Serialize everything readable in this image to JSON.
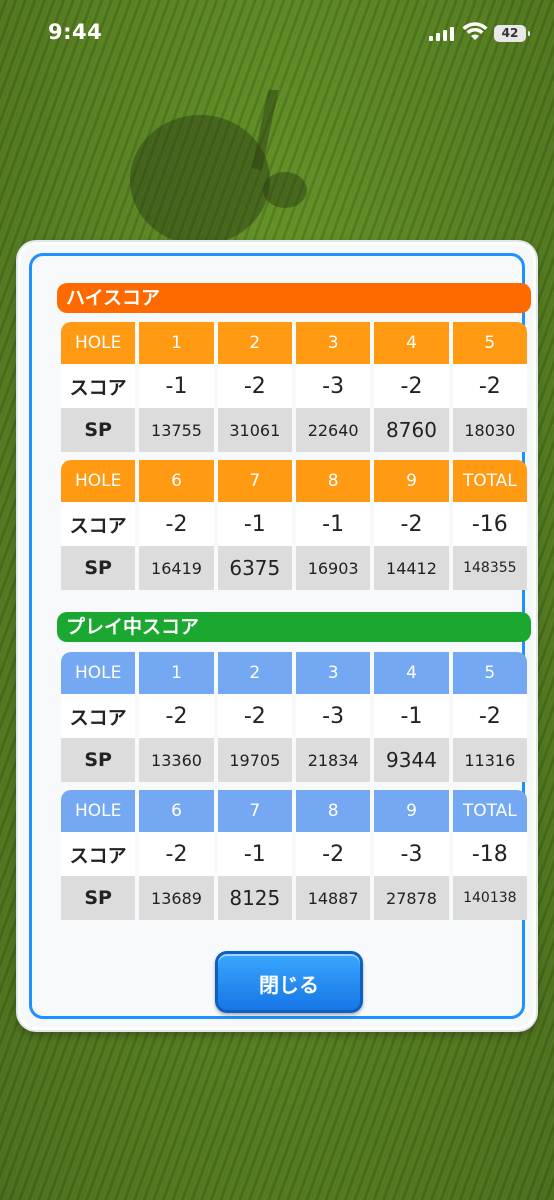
{
  "status_bar": {
    "time": "9:44",
    "battery": "42"
  },
  "high_score": {
    "title": "ハイスコア",
    "front": {
      "header": [
        "HOLE",
        "1",
        "2",
        "3",
        "4",
        "5"
      ],
      "score": [
        "スコア",
        "-1",
        "-2",
        "-3",
        "-2",
        "-2"
      ],
      "sp": [
        "SP",
        "13755",
        "31061",
        "22640",
        "8760",
        "18030"
      ]
    },
    "back": {
      "header": [
        "HOLE",
        "6",
        "7",
        "8",
        "9",
        "TOTAL"
      ],
      "score": [
        "スコア",
        "-2",
        "-1",
        "-1",
        "-2",
        "-16"
      ],
      "sp": [
        "SP",
        "16419",
        "6375",
        "16903",
        "14412",
        "148355"
      ]
    }
  },
  "current_score": {
    "title": "プレイ中スコア",
    "front": {
      "header": [
        "HOLE",
        "1",
        "2",
        "3",
        "4",
        "5"
      ],
      "score": [
        "スコア",
        "-2",
        "-2",
        "-3",
        "-1",
        "-2"
      ],
      "sp": [
        "SP",
        "13360",
        "19705",
        "21834",
        "9344",
        "11316"
      ]
    },
    "back": {
      "header": [
        "HOLE",
        "6",
        "7",
        "8",
        "9",
        "TOTAL"
      ],
      "score": [
        "スコア",
        "-2",
        "-1",
        "-2",
        "-3",
        "-18"
      ],
      "sp": [
        "SP",
        "13689",
        "8125",
        "14887",
        "27878",
        "140138"
      ]
    }
  },
  "close_label": "閉じる",
  "colors": {
    "orange": "#ff6a00",
    "green": "#1aa830",
    "blue": "#74a8f3",
    "button": "#1e88f0"
  }
}
